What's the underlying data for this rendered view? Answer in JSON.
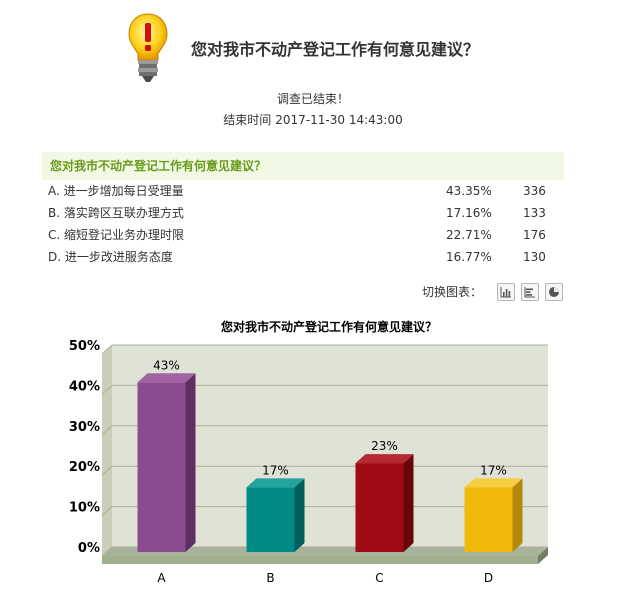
{
  "header": {
    "title": "您对我市不动产登记工作有何意见建议？",
    "icon": "lightbulb-warning-icon"
  },
  "survey": {
    "status": "调查已结束！",
    "end_label": "结束时间",
    "end_time": "2017-11-30 14:43:00"
  },
  "results": {
    "question": "您对我市不动产登记工作有何意见建议？",
    "options": [
      {
        "label": "A. 进一步增加每日受理量",
        "percent": "43.35%",
        "count": "336"
      },
      {
        "label": "B. 落实跨区互联办理方式",
        "percent": "17.16%",
        "count": "133"
      },
      {
        "label": "C. 缩短登记业务办理时限",
        "percent": "22.71%",
        "count": "176"
      },
      {
        "label": "D. 进一步改进服务态度",
        "percent": "16.77%",
        "count": "130"
      }
    ]
  },
  "chart_switch": {
    "label": "切换图表：",
    "buttons": [
      "bar-chart-icon",
      "horizontal-bar-chart-icon",
      "pie-chart-icon"
    ]
  },
  "chart_data": {
    "type": "bar",
    "title": "您对我市不动产登记工作有何意见建议？",
    "categories": [
      "A",
      "B",
      "C",
      "D"
    ],
    "values": [
      43,
      17,
      23,
      17
    ],
    "data_labels": [
      "43%",
      "17%",
      "23%",
      "17%"
    ],
    "yticks": [
      "0%",
      "10%",
      "20%",
      "30%",
      "40%",
      "50%"
    ],
    "ylim": [
      0,
      50
    ],
    "grid": true,
    "colors": [
      "#8b4b8f",
      "#008b87",
      "#a00a14",
      "#f0b80a"
    ],
    "side_colors": [
      "#5e2f61",
      "#005f5c",
      "#6b050c",
      "#b5880a"
    ],
    "top_colors": [
      "#a064a4",
      "#24a29e",
      "#b82830",
      "#f6cc40"
    ],
    "plot_background": "#dfe3d6",
    "floor_color": "#a7b39a"
  }
}
